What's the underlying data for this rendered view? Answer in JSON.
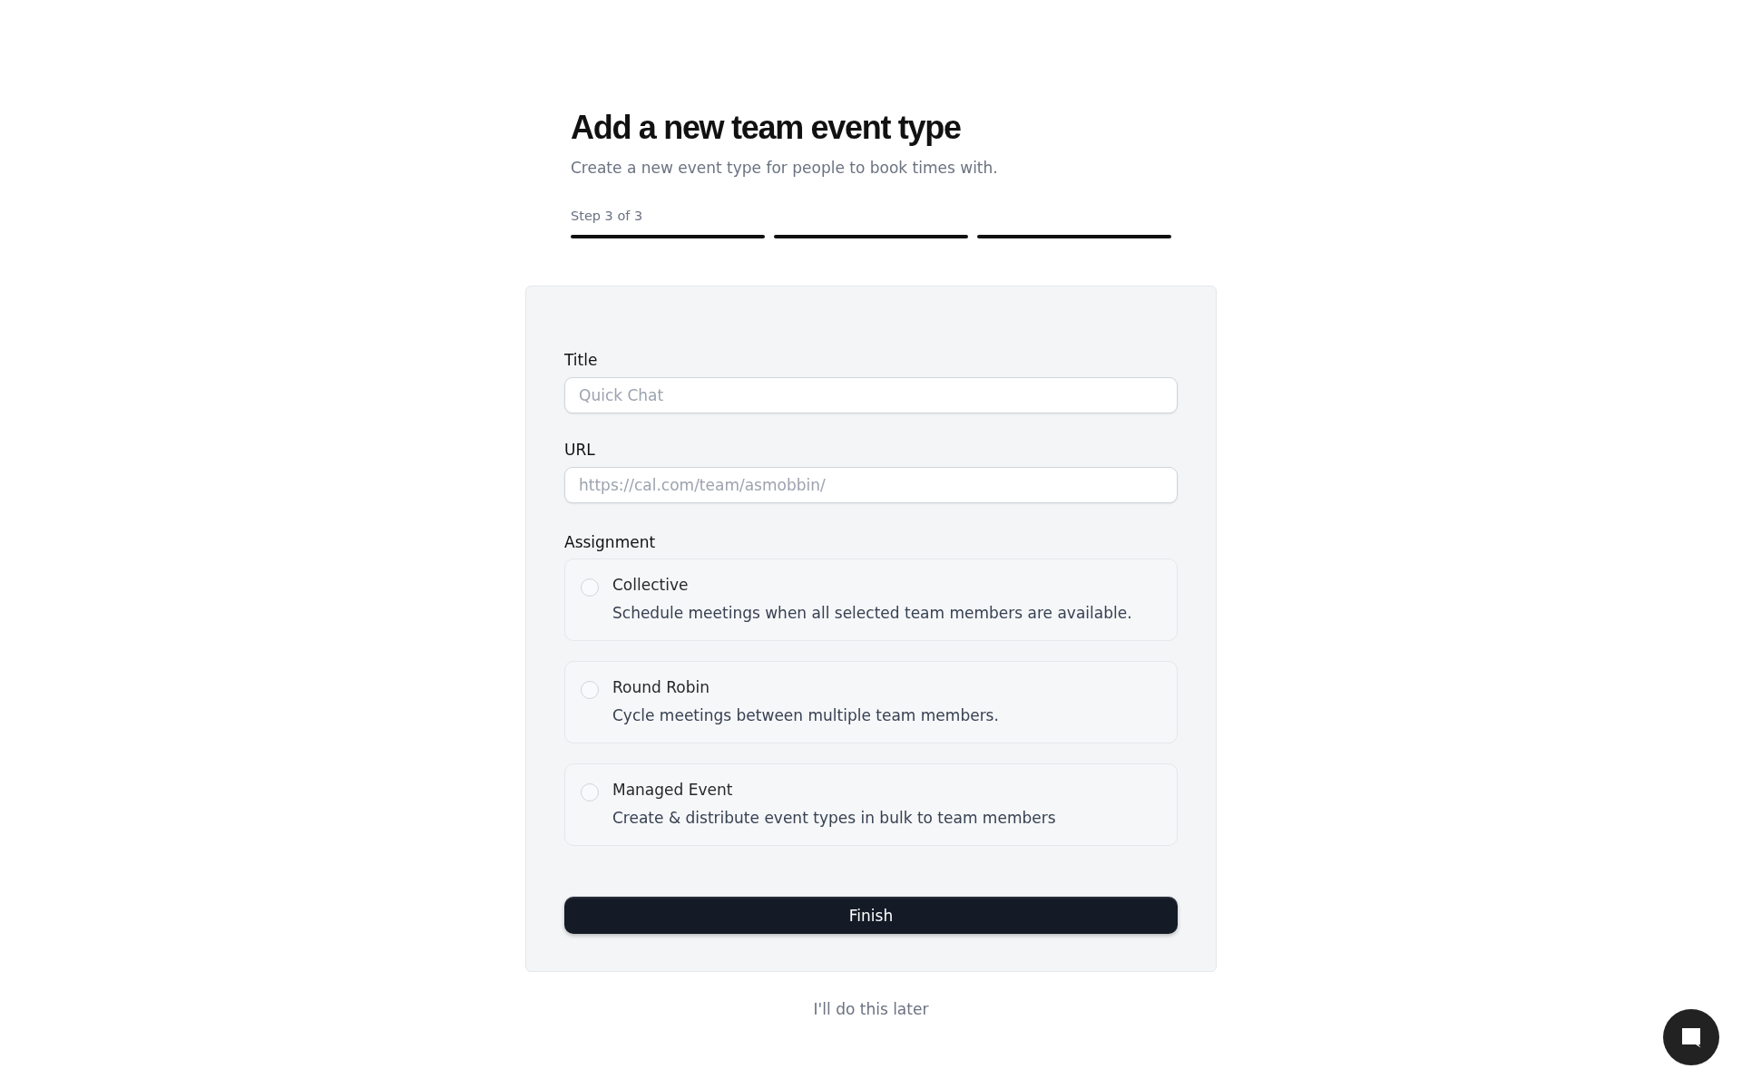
{
  "header": {
    "title": "Add a new team event type",
    "subtitle": "Create a new event type for people to book times with.",
    "step_label": "Step 3 of 3",
    "steps": [
      {
        "complete": true
      },
      {
        "complete": true
      },
      {
        "complete": true
      }
    ]
  },
  "form": {
    "fields": [
      {
        "label": "Title",
        "placeholder": "Quick Chat"
      },
      {
        "label": "URL",
        "placeholder": "https://cal.com/team/asmobbin/"
      }
    ],
    "assignment": {
      "label": "Assignment",
      "options": [
        {
          "title": "Collective",
          "description": "Schedule meetings when all selected team members are available.",
          "selected": false
        },
        {
          "title": "Round Robin",
          "description": "Cycle meetings between multiple team members.",
          "selected": false
        },
        {
          "title": "Managed Event",
          "description": "Create & distribute event types in bulk to team members",
          "selected": false
        }
      ]
    },
    "submit": "Finish"
  },
  "skip_link": "I'll do this later"
}
